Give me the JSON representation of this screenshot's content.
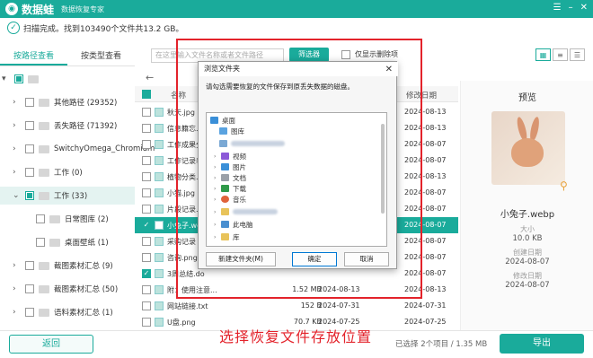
{
  "app": {
    "name": "数据蛙",
    "subtitle": "数据恢复专家",
    "logo_icon": "frog-logo-icon"
  },
  "window_controls": [
    "menu-icon",
    "minimize-icon",
    "close-icon"
  ],
  "status": {
    "text": "扫描完成。找到103490个文件共13.2 GB。"
  },
  "tabs": [
    {
      "label": "按路径查看",
      "active": true
    },
    {
      "label": "按类型查看",
      "active": false
    }
  ],
  "search": {
    "placeholder": "在这里输入文件名称或者文件路径"
  },
  "filter_button": "筛选器",
  "only_deleted": "仅显示删除项",
  "tree": [
    {
      "label": "其他路径 (29352)"
    },
    {
      "label": "丢失路径 (71392)"
    },
    {
      "label": "SwitchyOmega_Chromium"
    },
    {
      "label": "工作 (0)"
    },
    {
      "label": "工作 (33)"
    },
    {
      "label": "日常图库 (2)"
    },
    {
      "label": "桌面壁纸 (1)"
    },
    {
      "label": "截图素材汇总 (9)"
    },
    {
      "label": "截图素材汇总 (50)"
    },
    {
      "label": "语料素材汇总 (1)"
    }
  ],
  "list_header": {
    "name": "名称",
    "date": "修改日期"
  },
  "files": [
    {
      "name": "秋天.jpg",
      "size": "",
      "date": "",
      "date2": "2024-08-13"
    },
    {
      "name": "信息籍忘.t",
      "size": "",
      "date": "",
      "date2": "2024-08-13"
    },
    {
      "name": "工作成果分",
      "size": "",
      "date": "",
      "date2": "2024-08-07"
    },
    {
      "name": "工作记录表",
      "size": "",
      "date": "",
      "date2": "2024-08-07"
    },
    {
      "name": "植物分类.d",
      "size": "",
      "date": "",
      "date2": "2024-08-13"
    },
    {
      "name": "小猫.jpg",
      "size": "",
      "date": "",
      "date2": "2024-08-07"
    },
    {
      "name": "片段记录.",
      "size": "",
      "date": "",
      "date2": "2024-08-07"
    },
    {
      "name": "小兔子.we",
      "size": "",
      "date": "",
      "date2": "2024-08-07"
    },
    {
      "name": "采购记录",
      "size": "",
      "date": "",
      "date2": "2024-08-07"
    },
    {
      "name": "咨询.png",
      "size": "",
      "date": "",
      "date2": "2024-08-07"
    },
    {
      "name": "3周总结.do",
      "size": "",
      "date": "",
      "date2": "2024-08-07"
    },
    {
      "name": "附：使用注意...",
      "size": "1.52 MB",
      "date": "2024-08-13",
      "date2": "2024-08-13"
    },
    {
      "name": "网站链接.txt",
      "size": "152 B",
      "date": "2024-07-31",
      "date2": "2024-07-31"
    },
    {
      "name": "U盘.png",
      "size": "70.7 KB",
      "date": "2024-07-25",
      "date2": "2024-07-25"
    }
  ],
  "preview": {
    "title": "预览",
    "filename": "小兔子.webp",
    "size_label": "大小",
    "size": "10.0 KB",
    "created_label": "创建日期",
    "created": "2024-08-07",
    "modified_label": "修改日期",
    "modified": "2024-08-07",
    "zoom_icon": "magnifier-icon"
  },
  "dialog": {
    "title": "浏览文件夹",
    "prompt": "请勾选需要恢复的文件保存到原丢失数据的磁盘。",
    "tree": [
      "桌面",
      "图库",
      "视频",
      "图片",
      "文档",
      "下载",
      "音乐",
      "此电脑",
      "库"
    ],
    "new_folder": "新建文件夹(M)",
    "ok": "确定",
    "cancel": "取消"
  },
  "bottom": {
    "back": "返回",
    "caption": "选择恢复文件存放位置",
    "selection": "已选择 2个项目 / 1.35 MB",
    "export": "导出"
  },
  "colors": {
    "accent": "#1aab9b",
    "annotation": "#e3232b"
  }
}
